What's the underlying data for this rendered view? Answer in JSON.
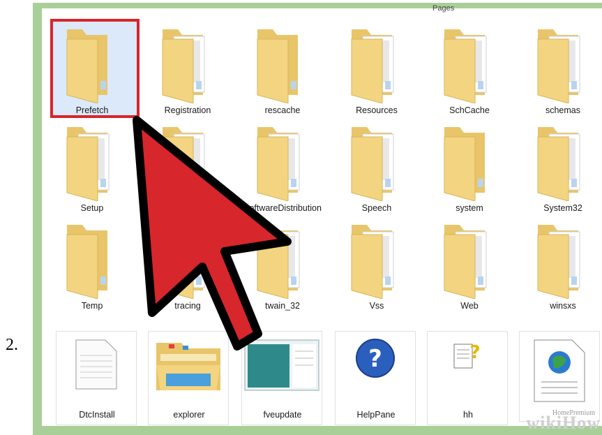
{
  "step_number": "2.",
  "top_cut_label": "Pages",
  "folders": [
    {
      "label": "Prefetch",
      "selected": true
    },
    {
      "label": "Registration"
    },
    {
      "label": "rescache"
    },
    {
      "label": "Resources"
    },
    {
      "label": "SchCache"
    },
    {
      "label": "schemas"
    },
    {
      "label": "Setup"
    },
    {
      "label": ""
    },
    {
      "label": "SoftwareDistribution"
    },
    {
      "label": "Speech"
    },
    {
      "label": "system"
    },
    {
      "label": "System32"
    },
    {
      "label": "Temp"
    },
    {
      "label": "tracing"
    },
    {
      "label": "twain_32"
    },
    {
      "label": "Vss"
    },
    {
      "label": "Web"
    },
    {
      "label": "winsxs"
    }
  ],
  "files": [
    {
      "label": "DtcInstall",
      "icon": "text-file-icon"
    },
    {
      "label": "explorer",
      "icon": "explorer-folder-icon"
    },
    {
      "label": "fveupdate",
      "icon": "window-thumbnail-icon"
    },
    {
      "label": "HelpPane",
      "icon": "help-question-icon"
    },
    {
      "label": "hh",
      "icon": "help-document-icon"
    },
    {
      "label": "",
      "icon": "web-document-icon"
    }
  ],
  "watermark": {
    "small": "HomePremium",
    "big": "wikiHow"
  },
  "colors": {
    "selection_border": "#d6262b",
    "arrow_fill": "#d7262c",
    "frame": "#a9cf99",
    "folder": "#f3d480"
  }
}
